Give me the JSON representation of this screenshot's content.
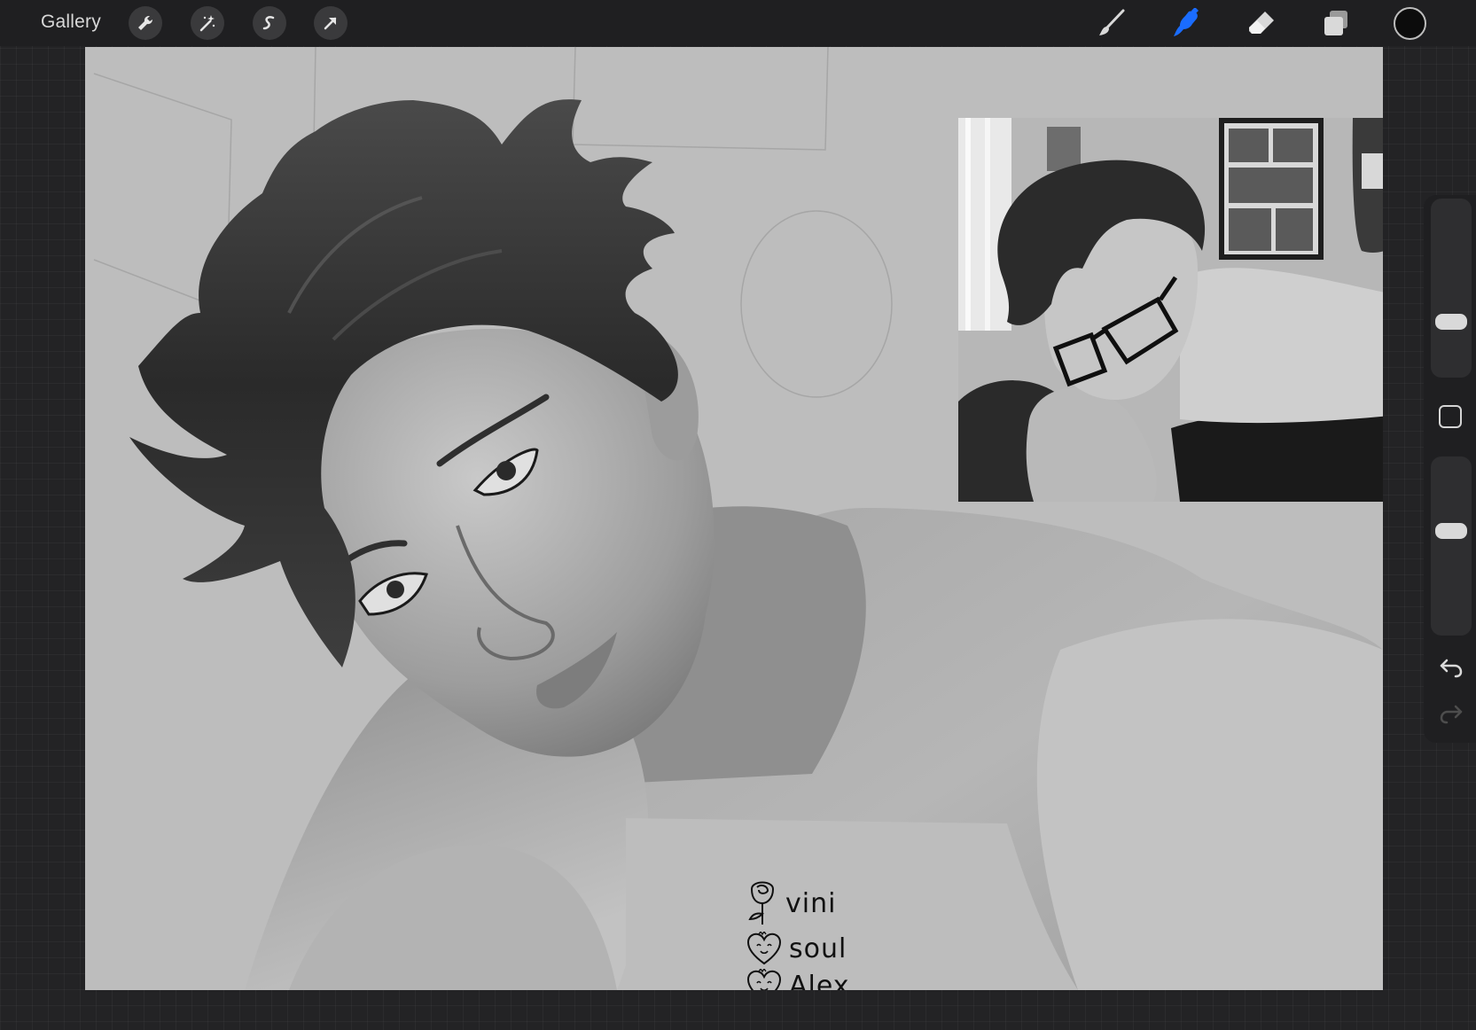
{
  "app": {
    "gallery_label": "Gallery"
  },
  "toolbar": {
    "left_tools": [
      "wrench-icon",
      "magic-wand-icon",
      "selection-icon",
      "transform-arrow-icon"
    ],
    "right_tools": [
      "brush-icon",
      "smudge-icon",
      "eraser-icon",
      "layers-icon"
    ],
    "active_tool": "smudge-icon",
    "accent_color": "#1a6cff",
    "current_color": "#0c0c0c"
  },
  "canvas": {
    "background_color": "#bdbdbd",
    "signature": {
      "lines": [
        "vini",
        "soul",
        "Alex"
      ]
    }
  },
  "sidebar": {
    "brush_size_level": 0.28,
    "opacity_level": 0.6,
    "undo_icon": "undo-arrow-icon",
    "redo_icon": "redo-arrow-icon"
  }
}
